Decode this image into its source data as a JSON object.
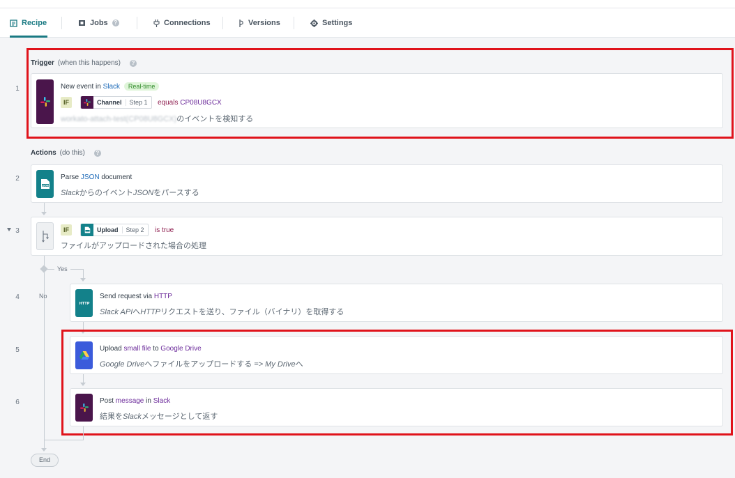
{
  "tabs": [
    {
      "label": "Recipe",
      "icon": "document-icon",
      "active": true
    },
    {
      "label": "Jobs",
      "icon": "flag-icon",
      "active": false
    },
    {
      "label": "Connections",
      "icon": "plug-icon",
      "active": false
    },
    {
      "label": "Versions",
      "icon": "branch-icon",
      "active": false
    },
    {
      "label": "Settings",
      "icon": "gear-icon",
      "active": false
    }
  ],
  "trigger": {
    "title": "Trigger",
    "subtitle": "(when this happens)",
    "step_number": "1",
    "line1_prefix": "New event in",
    "app": "Slack",
    "badge": "Real-time",
    "if_label": "IF",
    "pill_label": "Channel",
    "pill_step": "Step 1",
    "condition_op": "equals",
    "condition_value": "CP08U8GCX",
    "description_blurred": "workato-attach-test(CP08U8GCX)",
    "description_suffix": "のイベントを検知する"
  },
  "actions": {
    "title": "Actions",
    "subtitle": "(do this)"
  },
  "steps": {
    "s2": {
      "num": "2",
      "line1_a": "Parse",
      "line1_kw": "JSON",
      "line1_b": "document",
      "line2_i": "Slack",
      "line2": "からのイベント",
      "line2_i2": "JSON",
      "line2_b": "をパースする"
    },
    "s3": {
      "num": "3",
      "if_label": "IF",
      "pill_label": "Upload",
      "pill_step": "Step 2",
      "condition": "is true",
      "line2": "ファイルがアップロードされた場合の処理"
    },
    "s4": {
      "num": "4",
      "line1_a": "Send request via",
      "line1_kw": "HTTP",
      "line2_i": "Slack API",
      "line2_a": "へ",
      "line2_i2": "HTTP",
      "line2_b": "リクエストを送り、ファイル（バイナリ）を取得する"
    },
    "s5": {
      "num": "5",
      "line1_a": "Upload",
      "line1_kw": "small file",
      "line1_b": "to",
      "line1_kw2": "Google Drive",
      "line2_i": "Google Drive",
      "line2_a": "へファイルをアップロードする",
      "line2_i2": "=> My Drive",
      "line2_b": "へ"
    },
    "s6": {
      "num": "6",
      "line1_a": "Post",
      "line1_kw": "message",
      "line1_b": "in",
      "line1_kw2": "Slack",
      "line2_a": "結果を",
      "line2_i": "Slack",
      "line2_b": "メッセージとして返す"
    }
  },
  "branches": {
    "yes": "Yes",
    "no": "No"
  },
  "end_label": "End",
  "icon_labels": {
    "json": "JSON",
    "http": "HTTP"
  },
  "colors": {
    "accent": "#1a7a83",
    "highlight": "#e0131b",
    "slack": "#4a154b",
    "teal": "#13818a",
    "gdrive": "#3b5bdb"
  }
}
